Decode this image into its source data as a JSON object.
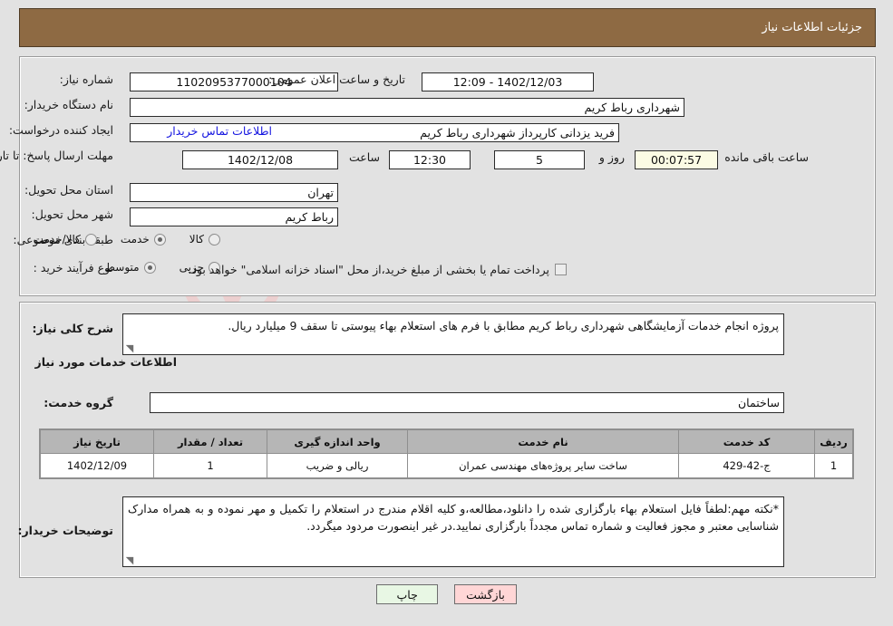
{
  "header": {
    "title": "جزئیات اطلاعات نیاز"
  },
  "form": {
    "need_number_label": "شماره نیاز:",
    "need_number_value": "1102095377000104",
    "announce_label": "تاریخ و ساعت اعلان عمومی:",
    "announce_value": "1402/12/03 - 12:09",
    "buyer_org_label": "نام دستگاه خریدار:",
    "buyer_org_value": "شهرداری رباط کریم",
    "creator_label": "ایجاد کننده درخواست:",
    "creator_value": "فرید یزدانی کارپرداز شهرداری رباط کریم",
    "contact_link": "اطلاعات تماس خریدار",
    "deadline_label": "مهلت ارسال پاسخ: تا تاریخ:",
    "deadline_date": "1402/12/08",
    "hour_label": "ساعت",
    "deadline_time": "12:30",
    "days_value": "5",
    "days_label": "روز و",
    "countdown_value": "00:07:57",
    "countdown_label": "ساعت باقی مانده",
    "province_label": "استان محل تحویل:",
    "province_value": "تهران",
    "city_label": "شهر محل تحویل:",
    "city_value": "رباط کریم",
    "category_label": "طبقه بندی موضوعی:",
    "category_options": [
      {
        "label": "کالا",
        "selected": false
      },
      {
        "label": "خدمت",
        "selected": true
      },
      {
        "label": "کالا/خدمت",
        "selected": false
      }
    ],
    "process_label": "نوع فرآیند خرید :",
    "process_options": [
      {
        "label": "جزیی",
        "selected": false
      },
      {
        "label": "متوسط",
        "selected": true
      }
    ],
    "treasury_checked": false,
    "treasury_note": "پرداخت تمام یا بخشی از مبلغ خرید،از محل \"اسناد خزانه اسلامی\" خواهد بود."
  },
  "body": {
    "summary_label": "شرح کلی نیاز:",
    "summary_value": "پروژه انجام خدمات آزمایشگاهی شهرداری رباط کریم مطابق با فرم های استعلام بهاء پیوستی تا سقف 9 میلیارد ریال.",
    "services_heading": "اطلاعات خدمات مورد نیاز",
    "service_group_label": "گروه خدمت:",
    "service_group_value": "ساختمان",
    "buyer_notes_label": "توضیحات خریدار:",
    "buyer_notes_value": "*نکته مهم:لطفاً فایل استعلام بهاء بارگزاری شده را دانلود،مطالعه،و کلیه اقلام مندرج در استعلام را تکمیل و مهر نموده و به همراه مدارک شناسایی معتبر و مجوز فعالیت و شماره تماس مجدداً بارگزاری نمایید.در غیر اینصورت مردود میگردد."
  },
  "table": {
    "columns": [
      "ردیف",
      "کد خدمت",
      "نام خدمت",
      "واحد اندازه گیری",
      "تعداد / مقدار",
      "تاریخ نیاز"
    ],
    "rows": [
      {
        "row": "1",
        "code": "ج-42-429",
        "name": "ساخت سایر پروژه‌های مهندسی عمران",
        "unit": "ریالی و ضریب",
        "qty": "1",
        "date": "1402/12/09"
      }
    ]
  },
  "footer": {
    "print_label": "چاپ",
    "back_label": "بازگشت"
  },
  "watermark": {
    "text": "AriaTender",
    "suffix": ".net"
  },
  "colors": {
    "header_bg": "#8e6a43",
    "panel_bg": "#e2e2e2",
    "link": "#1414e0",
    "countdown_bg": "#fbfbe4",
    "table_header_bg": "#b6b6b6",
    "btn_back_bg": "#ffd6d6",
    "btn_print_bg": "#e8f7e4"
  }
}
